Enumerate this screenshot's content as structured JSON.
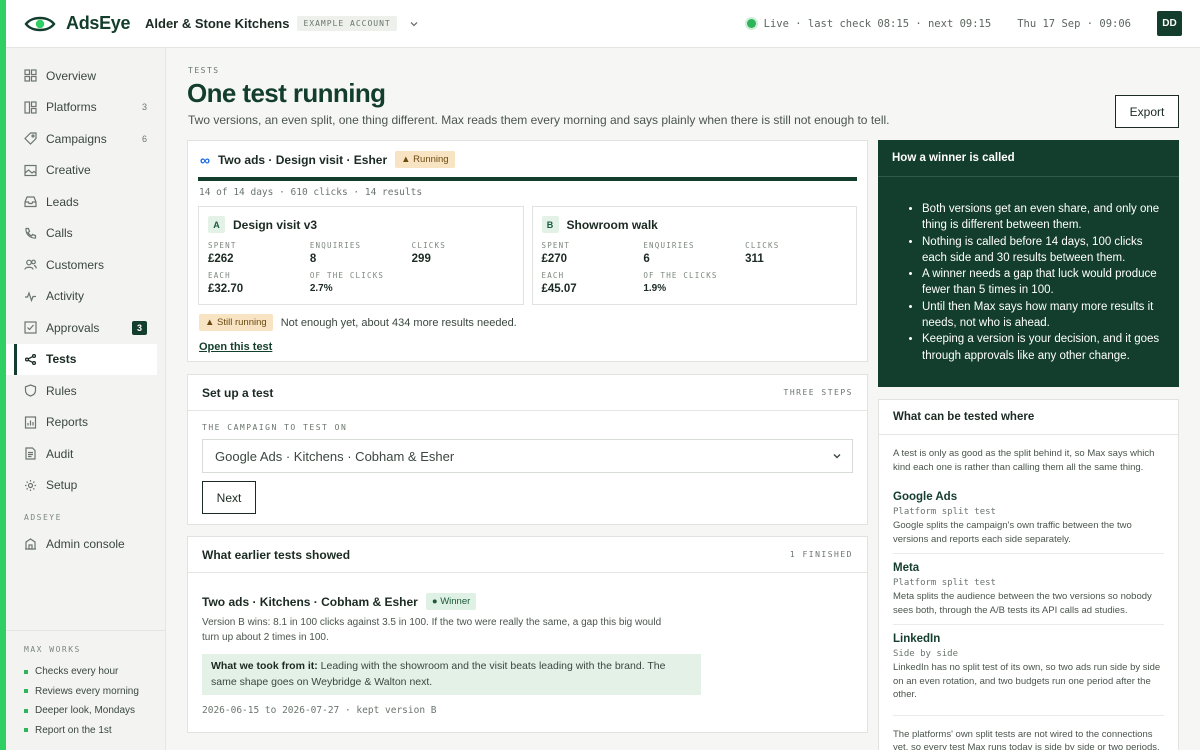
{
  "brand": {
    "name": "AdsEye"
  },
  "account": {
    "name": "Alder & Stone Kitchens",
    "tag": "EXAMPLE ACCOUNT"
  },
  "status": {
    "live_text": "Live · last check 08:15 · next 09:15",
    "datetime": "Thu 17 Sep · 09:06",
    "user_initials": "DD"
  },
  "sidebar": {
    "items": [
      {
        "label": "Overview",
        "icon": "grid-icon",
        "count": ""
      },
      {
        "label": "Platforms",
        "icon": "platforms-icon",
        "count": "3"
      },
      {
        "label": "Campaigns",
        "icon": "tag-icon",
        "count": "6"
      },
      {
        "label": "Creative",
        "icon": "image-icon",
        "count": ""
      },
      {
        "label": "Leads",
        "icon": "inbox-icon",
        "count": ""
      },
      {
        "label": "Calls",
        "icon": "phone-icon",
        "count": ""
      },
      {
        "label": "Customers",
        "icon": "users-icon",
        "count": ""
      },
      {
        "label": "Activity",
        "icon": "pulse-icon",
        "count": ""
      },
      {
        "label": "Approvals",
        "icon": "check-square-icon",
        "count": "3"
      },
      {
        "label": "Tests",
        "icon": "split-icon",
        "count": ""
      },
      {
        "label": "Rules",
        "icon": "shield-icon",
        "count": ""
      },
      {
        "label": "Reports",
        "icon": "report-icon",
        "count": ""
      },
      {
        "label": "Audit",
        "icon": "document-icon",
        "count": ""
      },
      {
        "label": "Setup",
        "icon": "gear-icon",
        "count": ""
      }
    ],
    "section_label": "ADSEYE",
    "admin_label": "Admin console",
    "max_works": {
      "label": "MAX WORKS",
      "items": [
        "Checks every hour",
        "Reviews every morning",
        "Deeper look, Mondays",
        "Report on the 1st"
      ]
    }
  },
  "page": {
    "crumb": "TESTS",
    "title": "One test running",
    "subtitle": "Two versions, an even split, one thing different. Max reads them every morning and says plainly when there is still not enough to tell.",
    "export_label": "Export"
  },
  "running_test": {
    "platform_glyph": "∞",
    "title": "Two ads · Design visit · Esher",
    "status_pill": "▲ Running",
    "progress": 1.0,
    "stats": "14 of 14 days · 610 clicks · 14 results",
    "variants": [
      {
        "letter": "A",
        "name": "Design visit v3",
        "spent_label": "SPENT",
        "spent": "£262",
        "enq_label": "ENQUIRIES",
        "enq": "8",
        "clicks_label": "CLICKS",
        "clicks": "299",
        "each_label": "EACH",
        "each": "£32.70",
        "share_label": "OF THE CLICKS",
        "share": "2.7%"
      },
      {
        "letter": "B",
        "name": "Showroom walk",
        "spent_label": "SPENT",
        "spent": "£270",
        "enq_label": "ENQUIRIES",
        "enq": "6",
        "clicks_label": "CLICKS",
        "clicks": "311",
        "each_label": "EACH",
        "each": "£45.07",
        "share_label": "OF THE CLICKS",
        "share": "1.9%"
      }
    ],
    "still_pill": "▲ Still running",
    "still_text": "Not enough yet, about 434 more results needed.",
    "open_link": "Open this test"
  },
  "setup": {
    "title": "Set up a test",
    "tag": "THREE STEPS",
    "field_label": "THE CAMPAIGN TO TEST ON",
    "selected": "Google Ads · Kitchens · Cobham & Esher",
    "next_label": "Next"
  },
  "earlier": {
    "title": "What earlier tests showed",
    "tag": "1 FINISHED",
    "test_title": "Two ads · Kitchens · Cobham & Esher",
    "winner_pill": "● Winner",
    "desc": "Version B wins: 8.1 in 100 clicks against 3.5 in 100. If the two were really the same, a gap this big would turn up about 2 times in 100.",
    "took_label": "What we took from it:",
    "took_text": " Leading with the showroom and the visit beats leading with the brand. The same shape goes on Weybridge & Walton next.",
    "foot": "2026-06-15 to 2026-07-27 · kept version B"
  },
  "winner_rules": {
    "title": "How a winner is called",
    "items": [
      "Both versions get an even share, and only one thing is different between them.",
      "Nothing is called before 14 days, 100 clicks each side and 30 results between them.",
      "A winner needs a gap that luck would produce fewer than 5 times in 100.",
      "Until then Max says how many more results it needs, not who is ahead.",
      "Keeping a version is your decision, and it goes through approvals like any other change."
    ]
  },
  "tested_where": {
    "title": "What can be tested where",
    "intro": "A test is only as good as the split behind it, so Max says which kind each one is rather than calling them all the same thing.",
    "platforms": [
      {
        "name": "Google Ads",
        "kind": "Platform split test",
        "desc": "Google splits the campaign's own traffic between the two versions and reports each side separately."
      },
      {
        "name": "Meta",
        "kind": "Platform split test",
        "desc": "Meta splits the audience between the two versions so nobody sees both, through the A/B tests its API calls ad studies."
      },
      {
        "name": "LinkedIn",
        "kind": "Side by side",
        "desc": "LinkedIn has no split test of its own, so two ads run side by side on an even rotation, and two budgets run one period after the other."
      }
    ],
    "foot": "The platforms' own split tests are not wired to the connections yet, so every test Max runs today is side by side or two periods, and says so on the test."
  }
}
